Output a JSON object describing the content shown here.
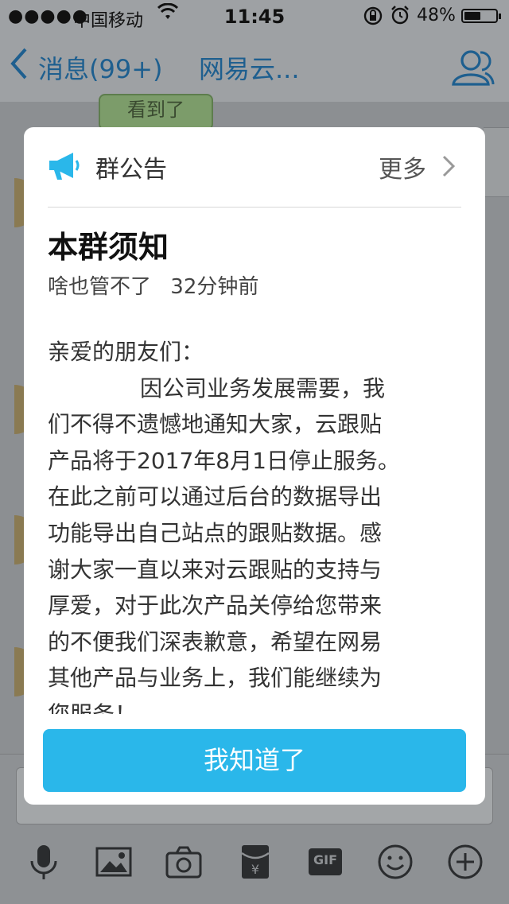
{
  "status_bar": {
    "signal": "●●●●●",
    "carrier": "中国移动",
    "time": "11:45",
    "battery_percent": "48%",
    "battery_level": 0.48,
    "icons": [
      "signal-icon",
      "wifi-icon",
      "rotation-lock-icon",
      "alarm-icon",
      "battery-icon"
    ]
  },
  "nav": {
    "back_label": "消息(99+)",
    "title": "网易云...",
    "right_icon": "group-members-icon"
  },
  "chat_background": {
    "bubble_text": "看到了"
  },
  "announcement": {
    "header_label": "群公告",
    "more_label": "更多",
    "title": "本群须知",
    "author": "啥也管不了",
    "time": "32分钟前",
    "body_lines": [
      "亲爱的朋友们：",
      "因公司业务发展需要，我",
      "们不得不遗憾地通知大家，云跟贴",
      "产品将于2017年8月1日停止服务。",
      "在此之前可以通过后台的数据导出",
      "功能导出自己站点的跟贴数据。感",
      "谢大家一直以来对云跟贴的支持与",
      "厚爱，对于此次产品关停给您带来",
      "的不便我们深表歉意，希望在网易",
      "其他产品与业务上，我们能继续为",
      "您服务！"
    ],
    "confirm_label": "我知道了"
  },
  "composer": {
    "tools": [
      "microphone-icon",
      "image-icon",
      "camera-icon",
      "red-packet-icon",
      "gif-icon",
      "emoji-icon",
      "plus-icon"
    ],
    "gif_label": "GIF"
  },
  "colors": {
    "accent": "#2ab7ea",
    "overlay": "#8c8f92",
    "nav_blue": "#1e5f8f"
  }
}
